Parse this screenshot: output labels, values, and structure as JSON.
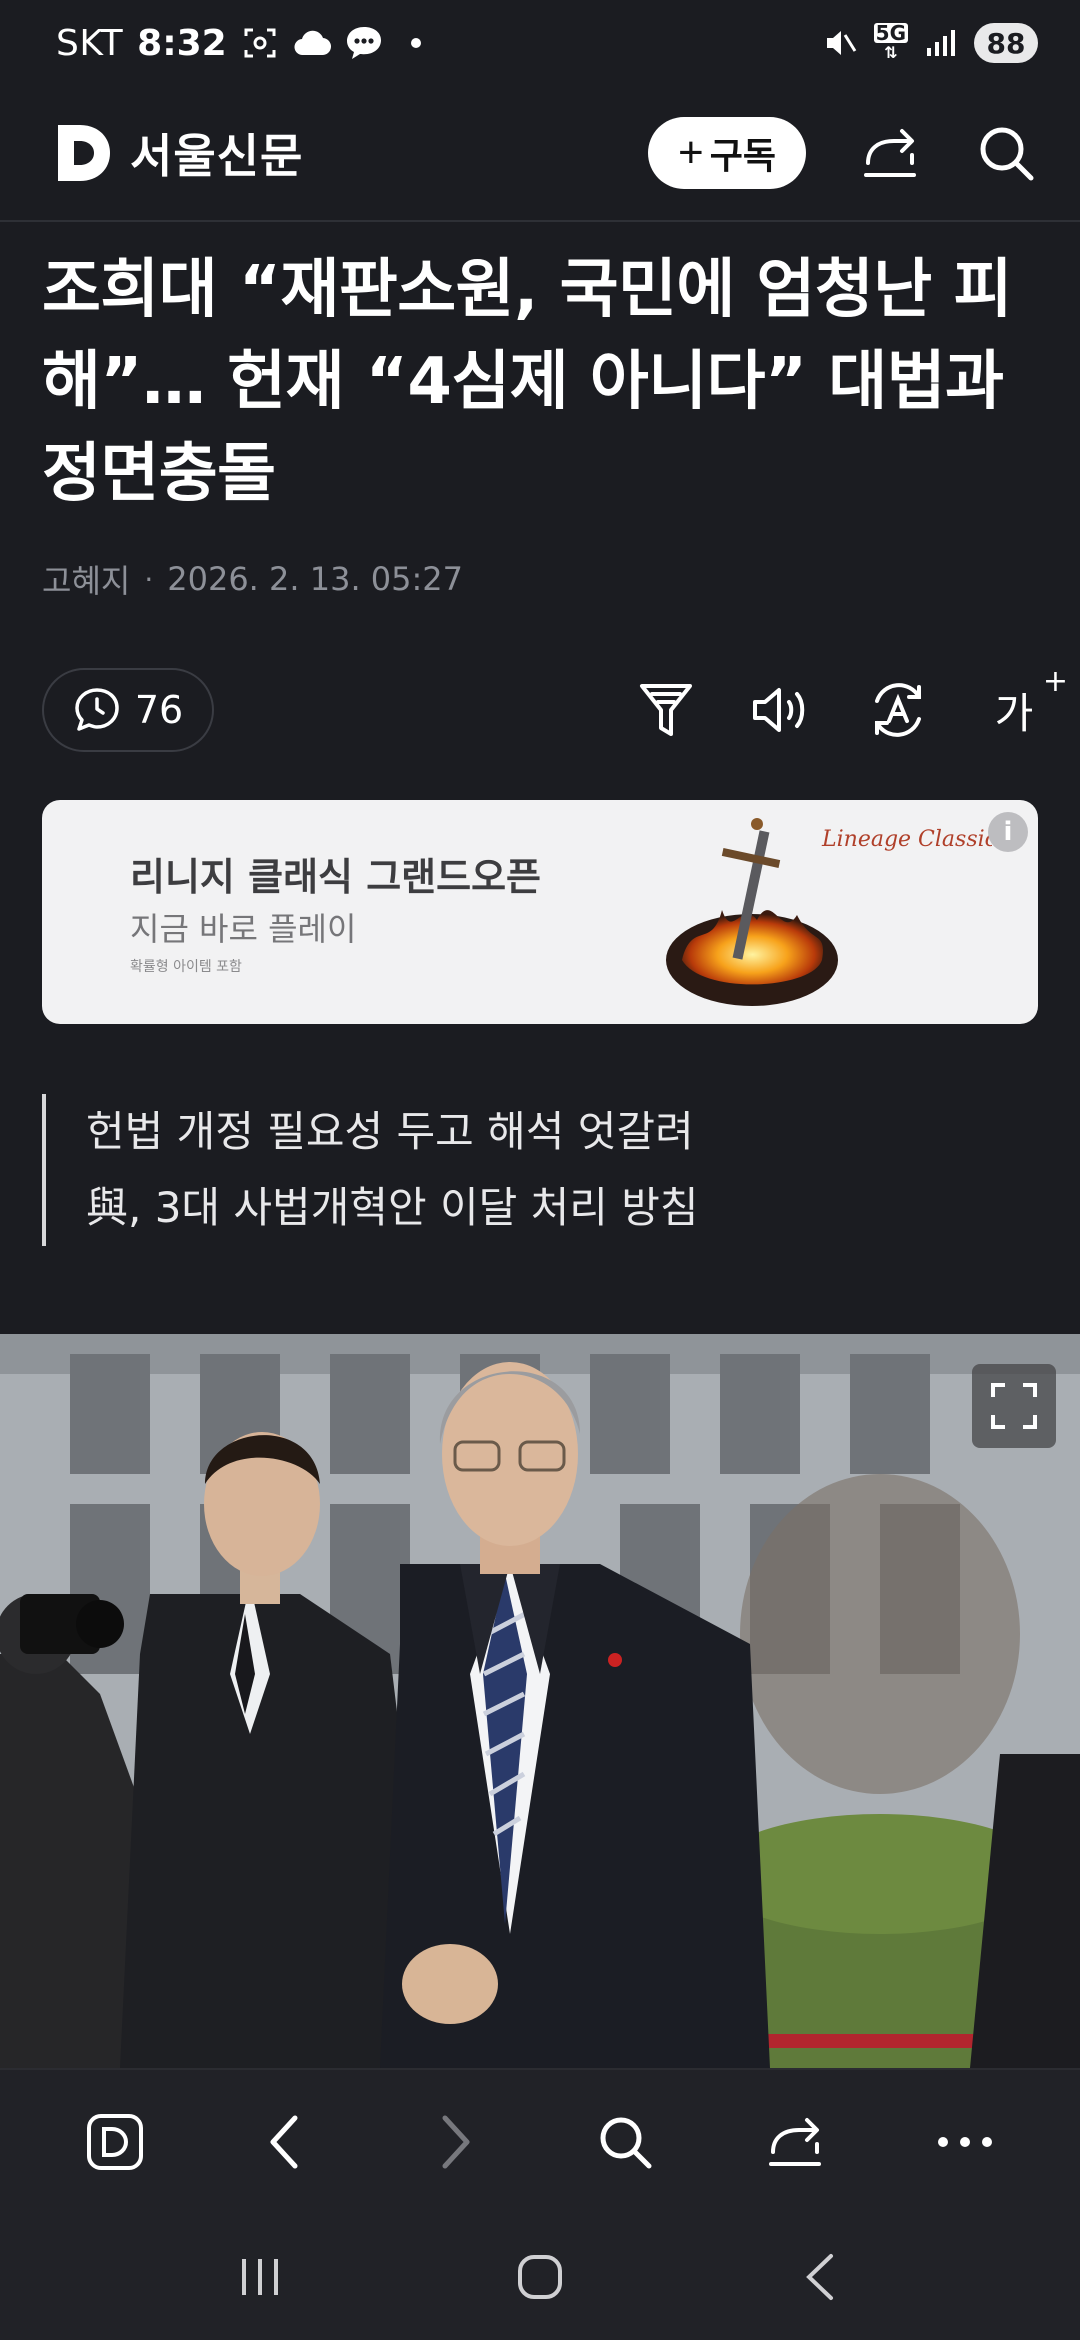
{
  "status_bar": {
    "carrier": "SKT",
    "time": "8:32",
    "network": "5G",
    "battery": "88",
    "icons": [
      "screenshot-icon",
      "cloud-icon",
      "chat-bubble-icon",
      "dot-icon",
      "mute-icon",
      "signal-icon"
    ]
  },
  "header": {
    "brand": "서울신문",
    "subscribe_label": "구독",
    "subscribe_plus": "+",
    "icons": [
      "share-icon",
      "search-icon"
    ]
  },
  "article": {
    "title": "조희대 “재판소원, 국민에 엄청난 피해”… 헌재 “4심제 아니다” 대법과 정면충돌",
    "author": "고혜지",
    "separator": "·",
    "date": "2026. 2. 13. 05:27",
    "comment_count": "76",
    "summary": [
      "헌법 개정 필요성 두고 해석 엇갈려",
      "與, 3대 사법개혁안 이달 처리 방침"
    ]
  },
  "tools": {
    "font_size_label": "가",
    "font_size_plus": "+",
    "icons": [
      "filter-icon",
      "speaker-icon",
      "translate-icon",
      "font-size-icon"
    ]
  },
  "ad": {
    "title": "리니지 클래식 그랜드오픈",
    "subtitle": "지금 바로 플레이",
    "fine_print": "확률형 아이템 포함",
    "info": "i",
    "logo_text": "Lineage Classic"
  },
  "photo": {
    "fullscreen_icon": "fullscreen-icon"
  },
  "bottom_nav": {
    "icons": [
      "home-logo-icon",
      "back-icon",
      "forward-icon",
      "search-icon",
      "share-icon",
      "more-icon"
    ]
  },
  "system_nav": {
    "icons": [
      "recents-icon",
      "home-icon",
      "back-icon"
    ]
  },
  "colors": {
    "background": "#1b1c21",
    "nav_background": "#212227",
    "text_muted": "#8d9098",
    "ad_background": "#f2f2f3"
  }
}
